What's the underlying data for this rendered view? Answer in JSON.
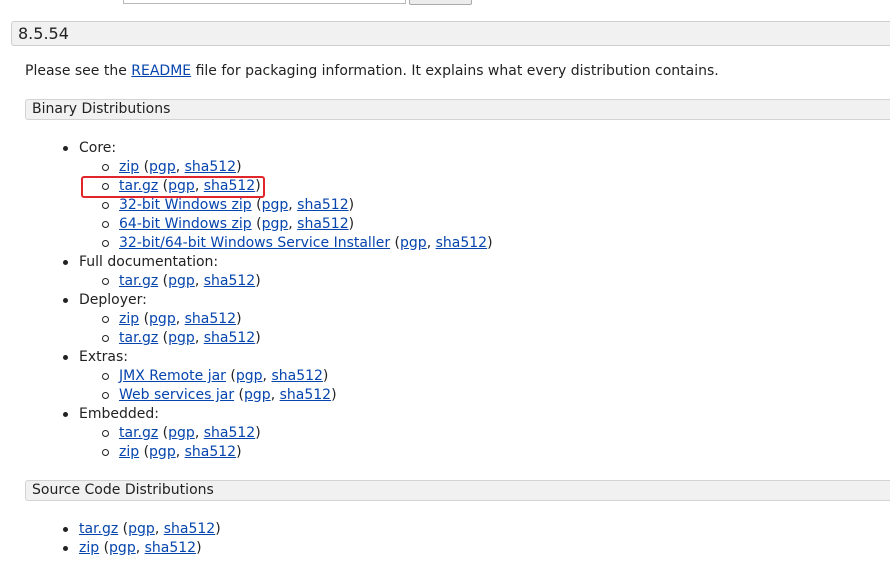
{
  "version_title": "8.5.54",
  "intro": {
    "before": "Please see the ",
    "readme_link": "README",
    "after": " file for packaging information. It explains what every distribution contains."
  },
  "binary": {
    "title": "Binary Distributions",
    "groups": [
      {
        "label": "Core:",
        "items": [
          {
            "name": "zip",
            "pgp": "pgp",
            "sha": "sha512"
          },
          {
            "name": "tar.gz",
            "pgp": "pgp",
            "sha": "sha512"
          },
          {
            "name": "32-bit Windows zip",
            "pgp": "pgp",
            "sha": "sha512"
          },
          {
            "name": "64-bit Windows zip",
            "pgp": "pgp",
            "sha": "sha512"
          },
          {
            "name": "32-bit/64-bit Windows Service Installer",
            "pgp": "pgp",
            "sha": "sha512"
          }
        ]
      },
      {
        "label": "Full documentation:",
        "items": [
          {
            "name": "tar.gz",
            "pgp": "pgp",
            "sha": "sha512"
          }
        ]
      },
      {
        "label": "Deployer:",
        "items": [
          {
            "name": "zip",
            "pgp": "pgp",
            "sha": "sha512"
          },
          {
            "name": "tar.gz",
            "pgp": "pgp",
            "sha": "sha512"
          }
        ]
      },
      {
        "label": "Extras:",
        "items": [
          {
            "name": "JMX Remote jar",
            "pgp": "pgp",
            "sha": "sha512"
          },
          {
            "name": "Web services jar",
            "pgp": "pgp",
            "sha": "sha512"
          }
        ]
      },
      {
        "label": "Embedded:",
        "items": [
          {
            "name": "tar.gz",
            "pgp": "pgp",
            "sha": "sha512"
          },
          {
            "name": "zip",
            "pgp": "pgp",
            "sha": "sha512"
          }
        ]
      }
    ]
  },
  "source": {
    "title": "Source Code Distributions",
    "items": [
      {
        "name": "tar.gz",
        "pgp": "pgp",
        "sha": "sha512"
      },
      {
        "name": "zip",
        "pgp": "pgp",
        "sha": "sha512"
      }
    ]
  },
  "punct": {
    "open": " (",
    "comma": ", ",
    "close": ")"
  },
  "colors": {
    "link": "#0645ad",
    "highlight": "#e0262b",
    "header_bg": "#f1f1f1"
  }
}
